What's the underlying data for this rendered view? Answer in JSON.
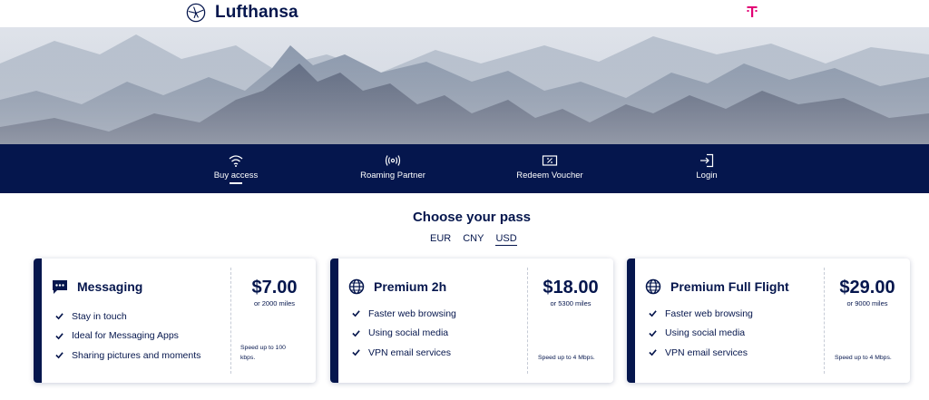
{
  "header": {
    "brand_name": "Lufthansa",
    "brand_icon": "crane-logo-icon",
    "partner_icon": "telekom-t-icon",
    "colors": {
      "brand": "#05164d",
      "telekom": "#e20074"
    }
  },
  "nav": {
    "items": [
      {
        "label": "Buy access",
        "icon": "wifi-icon",
        "active": true
      },
      {
        "label": "Roaming Partner",
        "icon": "roaming-icon",
        "active": false
      },
      {
        "label": "Redeem Voucher",
        "icon": "voucher-icon",
        "active": false
      },
      {
        "label": "Login",
        "icon": "login-icon",
        "active": false
      }
    ]
  },
  "section": {
    "title": "Choose your pass"
  },
  "currencies": {
    "options": [
      "EUR",
      "CNY",
      "USD"
    ],
    "selected": "USD"
  },
  "passes": [
    {
      "title": "Messaging",
      "icon": "chat-bubble-icon",
      "features": [
        "Stay in touch",
        "Ideal for Messaging Apps",
        "Sharing pictures and moments"
      ],
      "price": "$7.00",
      "miles": "or 2000 miles",
      "speed_line1": "Speed up to 100",
      "speed_line2": "kbps."
    },
    {
      "title": "Premium 2h",
      "icon": "globe-icon",
      "features": [
        "Faster web browsing",
        "Using social media",
        "VPN email services"
      ],
      "price": "$18.00",
      "miles": "or 5300 miles",
      "speed_line1": "Speed up to 4 Mbps.",
      "speed_line2": ""
    },
    {
      "title": "Premium Full Flight",
      "icon": "globe-icon",
      "features": [
        "Faster web browsing",
        "Using social media",
        "VPN email services"
      ],
      "price": "$29.00",
      "miles": "or 9000 miles",
      "speed_line1": "Speed up to 4 Mbps.",
      "speed_line2": ""
    }
  ]
}
